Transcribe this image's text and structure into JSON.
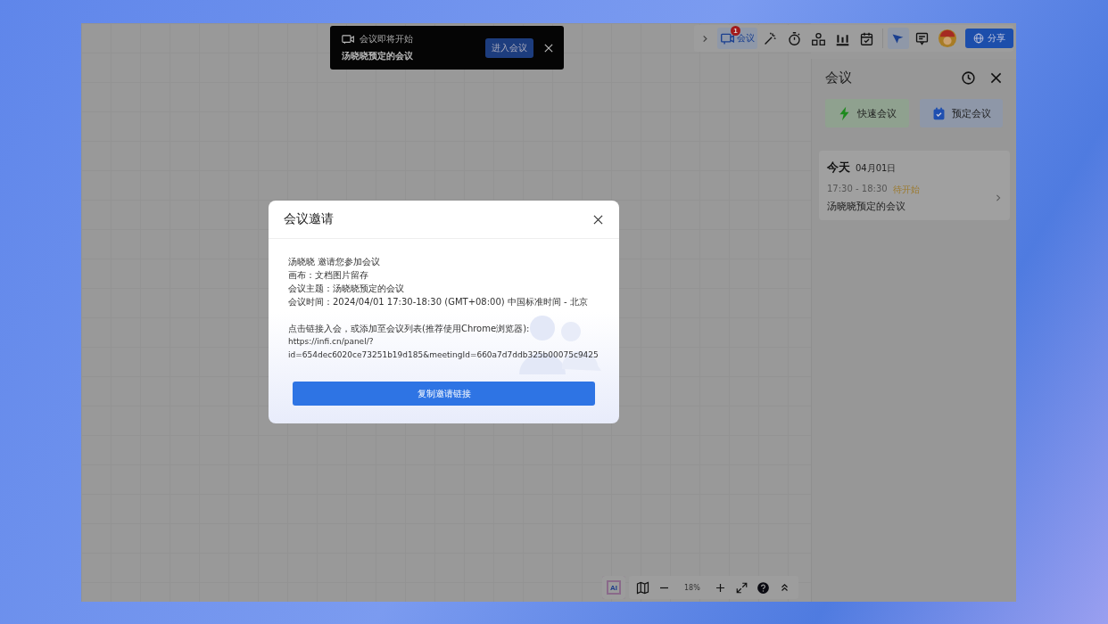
{
  "toast": {
    "title": "会议即将开始",
    "subtitle": "汤晓晓预定的会议",
    "button": "进入会议"
  },
  "toolbar": {
    "tools": [
      {
        "kind": "meeting",
        "label": "会议",
        "badge": "1",
        "selected": true
      },
      {
        "kind": "wand",
        "selected": false
      },
      {
        "kind": "timer",
        "selected": false
      },
      {
        "kind": "vote",
        "selected": false
      },
      {
        "kind": "chart",
        "selected": false
      },
      {
        "kind": "calendar",
        "selected": false
      },
      {
        "kind": "pointer",
        "selected": true
      },
      {
        "kind": "comment",
        "selected": false
      }
    ],
    "share": "分享"
  },
  "panel": {
    "title": "会议",
    "actions": [
      {
        "kind": "quick",
        "label": "快速会议"
      },
      {
        "kind": "schedule",
        "label": "预定会议"
      }
    ],
    "day": {
      "heading": "今天",
      "date": "04月01日",
      "meetings": [
        {
          "time": "17:30 - 18:30",
          "status": "待开始",
          "title": "汤晓晓预定的会议"
        }
      ]
    }
  },
  "dialog": {
    "title": "会议邀请",
    "lines": [
      "汤晓晓 邀请您参加会议",
      "画布：文档图片留存",
      "会议主题：汤晓晓预定的会议",
      "会议时间：2024/04/01 17:30-18:30 (GMT+08:00) 中国标准时间 - 北京"
    ],
    "link_intro": "点击链接入会，或添加至会议列表(推荐使用Chrome浏览器):",
    "link": [
      "https://infi.cn/panel/?",
      "id=654dec6020ce73251b19d185&meetingId=660a7d7ddb325b00075c9425"
    ],
    "button": "复制邀请链接"
  },
  "zoom": {
    "ai": "AI",
    "value": "18%"
  }
}
